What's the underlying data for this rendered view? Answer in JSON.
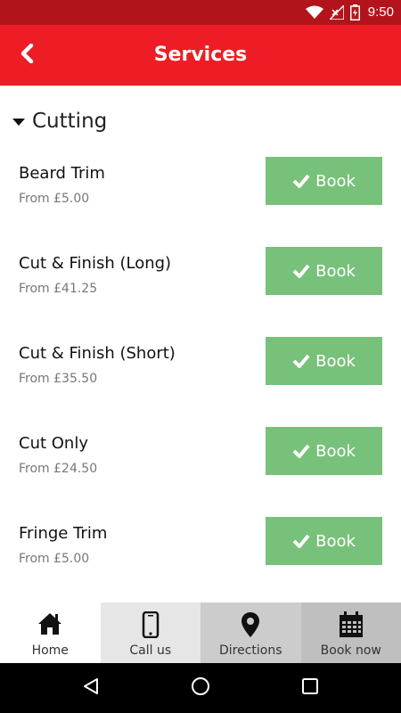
{
  "status_bar": {
    "time": "9:50"
  },
  "app_bar": {
    "title": "Services",
    "back_icon": "chevron-left-icon"
  },
  "section": {
    "title": "Cutting"
  },
  "services": [
    {
      "name": "Beard Trim",
      "price": "From £5.00",
      "button_label": "Book"
    },
    {
      "name": "Cut & Finish (Long)",
      "price": "From £41.25",
      "button_label": "Book"
    },
    {
      "name": "Cut & Finish (Short)",
      "price": "From £35.50",
      "button_label": "Book"
    },
    {
      "name": "Cut Only",
      "price": "From £24.50",
      "button_label": "Book"
    },
    {
      "name": "Fringe Trim",
      "price": "From £5.00",
      "button_label": "Book"
    }
  ],
  "bottom_nav": [
    {
      "label": "Home",
      "icon": "home-icon",
      "bg": "#ffffff"
    },
    {
      "label": "Call us",
      "icon": "phone-icon",
      "bg": "#e6e6e6"
    },
    {
      "label": "Directions",
      "icon": "map-pin-icon",
      "bg": "#cccccc"
    },
    {
      "label": "Book now",
      "icon": "calendar-icon",
      "bg": "#bfbfbf"
    }
  ],
  "colors": {
    "status_bar": "#b3141b",
    "app_bar": "#ee1c24",
    "book_button": "#78c17a"
  }
}
